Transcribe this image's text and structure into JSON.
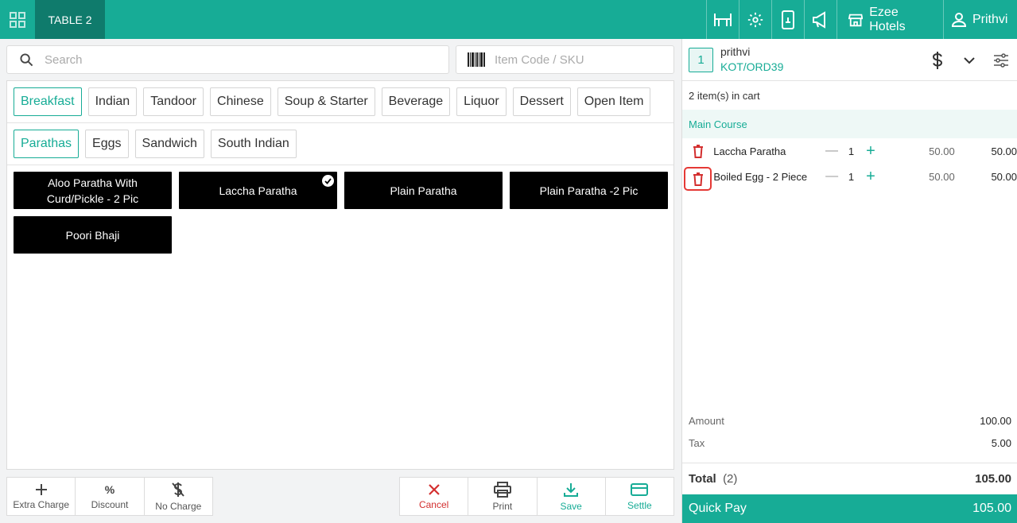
{
  "topbar": {
    "table_label": "TABLE 2",
    "hotel_name": "Ezee Hotels",
    "user_name": "Prithvi",
    "icons": [
      "grid-icon",
      "table-icon",
      "settings-icon",
      "mobile-order-icon",
      "announcement-icon",
      "store-icon",
      "user-icon"
    ]
  },
  "search": {
    "placeholder": "Search"
  },
  "sku": {
    "placeholder": "Item Code / SKU"
  },
  "categories": [
    "Breakfast",
    "Indian",
    "Tandoor",
    "Chinese",
    "Soup & Starter",
    "Beverage",
    "Liquor",
    "Dessert",
    "Open Item"
  ],
  "subcategories": [
    "Parathas",
    "Eggs",
    "Sandwich",
    "South Indian"
  ],
  "items": [
    {
      "name": "Aloo Paratha With Curd/Pickle - 2 Pic",
      "selected": false
    },
    {
      "name": "Laccha Paratha",
      "selected": true
    },
    {
      "name": "Plain Paratha",
      "selected": false
    },
    {
      "name": "Plain Paratha -2 Pic",
      "selected": false
    },
    {
      "name": "Poori Bhaji",
      "selected": false
    }
  ],
  "toolbar_left": {
    "extra_charge": "Extra Charge",
    "discount": "Discount",
    "no_charge": "No Charge"
  },
  "toolbar_right": {
    "cancel": "Cancel",
    "print": "Print",
    "save": "Save",
    "settle": "Settle"
  },
  "cart": {
    "guest_count": "1",
    "guest_name": "prithvi",
    "kot": "KOT/ORD39",
    "items_count": "2 item(s) in cart",
    "course": "Main Course",
    "lines": [
      {
        "name": "Laccha Paratha",
        "qty": "1",
        "rate": "50.00",
        "total": "50.00"
      },
      {
        "name": "Boiled Egg - 2 Piece",
        "qty": "1",
        "rate": "50.00",
        "total": "50.00"
      }
    ],
    "amount_label": "Amount",
    "amount": "100.00",
    "tax_label": "Tax",
    "tax": "5.00",
    "total_label": "Total",
    "total_count": "(2)",
    "total": "105.00",
    "quickpay_label": "Quick Pay",
    "quickpay_amount": "105.00"
  },
  "colors": {
    "accent": "#17ac96",
    "accent_dark": "#0f7b6c",
    "danger": "#d32f2f"
  }
}
